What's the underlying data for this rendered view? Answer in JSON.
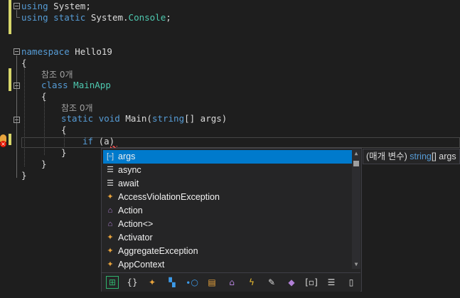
{
  "code": {
    "l1_kw": "using",
    "l1_rest": " System;",
    "l2_kw1": "using",
    "l2_kw2": "static",
    "l2_ns": " System.",
    "l2_ty": "Console",
    "l2_end": ";",
    "ns_kw": "namespace",
    "ns_name": " Hello19",
    "brace_open": "{",
    "brace_close": "}",
    "ref_class": "참조 0개",
    "class_kw": "class",
    "class_name": "MainApp",
    "ref_method": "참조 0개",
    "m_kw1": "static",
    "m_kw2": "void",
    "m_name": " Main(",
    "m_type": "string",
    "m_rest": "[] args)",
    "if_kw": "if",
    "if_rest": " (a)"
  },
  "completion": {
    "items": [
      {
        "label": "args",
        "icon": "local-variable-icon",
        "glyph": "[▫]",
        "color": "#dcdcdc"
      },
      {
        "label": "async",
        "icon": "keyword-icon",
        "glyph": "☰",
        "color": "#dcdcdc"
      },
      {
        "label": "await",
        "icon": "keyword-icon",
        "glyph": "☰",
        "color": "#dcdcdc"
      },
      {
        "label": "AccessViolationException",
        "icon": "class-icon",
        "glyph": "✦",
        "color": "#e8a33c"
      },
      {
        "label": "Action",
        "icon": "delegate-icon",
        "glyph": "⌂",
        "color": "#b180d7"
      },
      {
        "label": "Action<>",
        "icon": "delegate-icon",
        "glyph": "⌂",
        "color": "#b180d7"
      },
      {
        "label": "Activator",
        "icon": "class-icon",
        "glyph": "✦",
        "color": "#e8a33c"
      },
      {
        "label": "AggregateException",
        "icon": "class-icon",
        "glyph": "✦",
        "color": "#e8a33c"
      },
      {
        "label": "AppContext",
        "icon": "class-icon",
        "glyph": "✦",
        "color": "#e8a33c"
      }
    ],
    "filters": [
      {
        "name": "expand-filter-icon",
        "glyph": "⊞",
        "color": "#2fb46e"
      },
      {
        "name": "namespace-filter-icon",
        "glyph": "{}",
        "color": "#dcdcdc"
      },
      {
        "name": "class-filter-icon",
        "glyph": "✦",
        "color": "#e8a33c"
      },
      {
        "name": "struct-filter-icon",
        "glyph": "▚",
        "color": "#3c9ae8"
      },
      {
        "name": "interface-filter-icon",
        "glyph": "∙○",
        "color": "#3c9ae8"
      },
      {
        "name": "enum-filter-icon",
        "glyph": "▤",
        "color": "#e8a33c"
      },
      {
        "name": "delegate-filter-icon",
        "glyph": "⌂",
        "color": "#b180d7"
      },
      {
        "name": "event-filter-icon",
        "glyph": "ϟ",
        "color": "#f2c230"
      },
      {
        "name": "property-filter-icon",
        "glyph": "✎",
        "color": "#dcdcdc"
      },
      {
        "name": "method-filter-icon",
        "glyph": "◆",
        "color": "#b180d7"
      },
      {
        "name": "local-filter-icon",
        "glyph": "[▫]",
        "color": "#dcdcdc"
      },
      {
        "name": "keyword-filter-icon",
        "glyph": "☰",
        "color": "#dcdcdc"
      },
      {
        "name": "snippet-filter-icon",
        "glyph": "▯",
        "color": "#dcdcdc"
      }
    ]
  },
  "tooltip": {
    "prefix": "(매개 변수) ",
    "type": "string",
    "rest": "[] args"
  },
  "colors": {
    "keyword": "#569cd6",
    "type": "#4ec9b0",
    "selection": "#007acc",
    "margin_changed": "#d7d66a"
  }
}
